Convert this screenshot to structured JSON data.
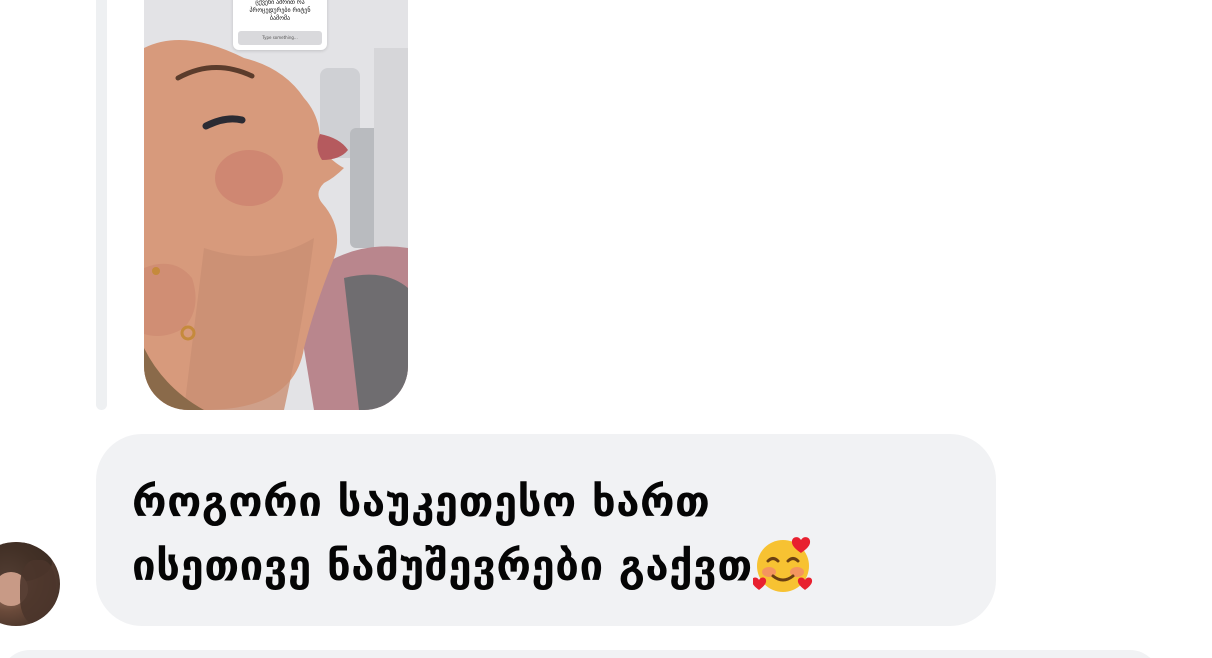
{
  "story": {
    "question_text": "ცქვენი ამრით რა პროცედურები რიტენ ბამომა",
    "input_placeholder": "Type something..."
  },
  "message": {
    "line1": "როგორი საუკეთესო ხართ",
    "line2": "ისეთივე ნამუშევრები გაქვთ",
    "emoji": "smiling-face-with-hearts-icon"
  },
  "colors": {
    "bubble_bg": "#f1f2f4",
    "reply_bar": "#eef0f2",
    "text": "#050505"
  }
}
